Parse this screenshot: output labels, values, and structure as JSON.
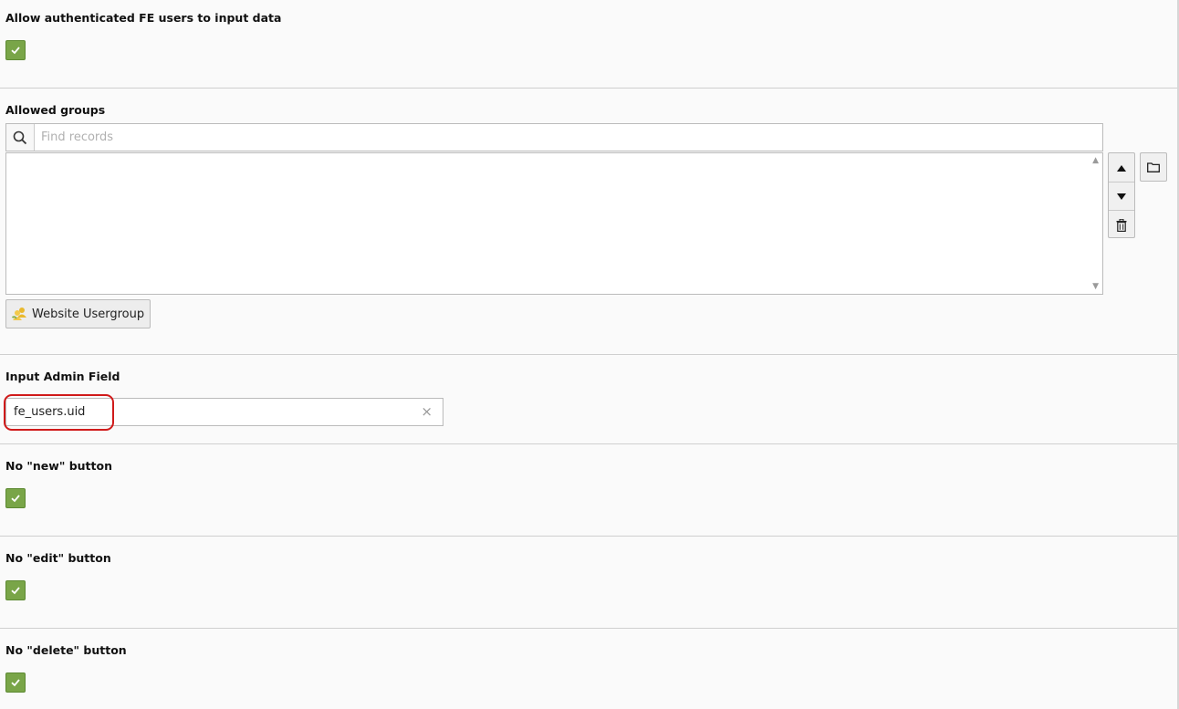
{
  "fields": {
    "allow_fe_users": {
      "label": "Allow authenticated FE users to input data",
      "checked": true
    },
    "allowed_groups": {
      "label": "Allowed groups",
      "search_placeholder": "Find records",
      "items": [],
      "add_button_label": "Website Usergroup"
    },
    "input_admin_field": {
      "label": "Input Admin Field",
      "value": "fe_users.uid"
    },
    "no_new_button": {
      "label": "No \"new\" button",
      "checked": true
    },
    "no_edit_button": {
      "label": "No \"edit\" button",
      "checked": true
    },
    "no_delete_button": {
      "label": "No \"delete\" button",
      "checked": true
    }
  },
  "colors": {
    "checkbox": "#79a548",
    "highlight": "#d01a1a"
  },
  "icons": [
    "check-icon",
    "search-icon",
    "arrow-up-icon",
    "arrow-down-icon",
    "trash-icon",
    "folder-icon",
    "usergroup-icon",
    "clear-icon"
  ]
}
